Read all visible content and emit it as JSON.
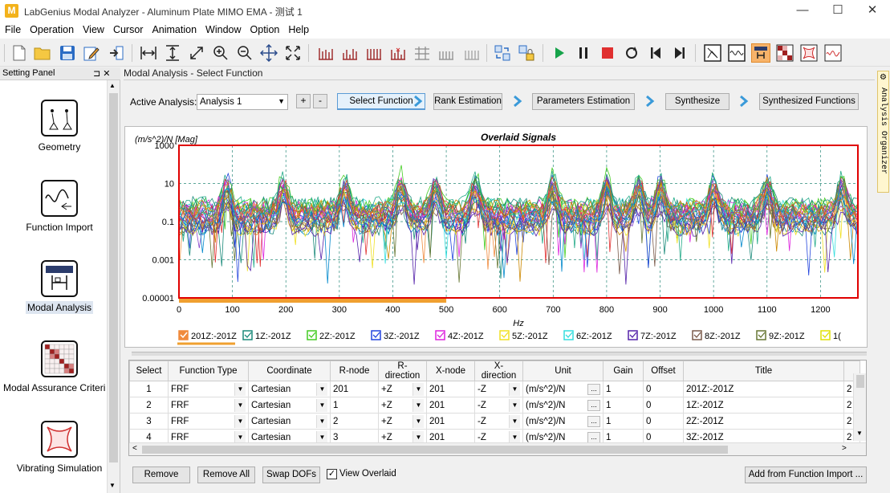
{
  "window": {
    "title": "LabGenius Modal Analyzer - Aluminum Plate MIMO EMA - 测试 1",
    "logo": "M",
    "minimize": "—",
    "maximize": "☐",
    "close": "✕"
  },
  "menu": [
    "File",
    "Operation",
    "View",
    "Cursor",
    "Animation",
    "Window",
    "Option",
    "Help"
  ],
  "toolbar_icons": [
    "new-file-icon",
    "open-folder-icon",
    "save-icon",
    "edit-icon",
    "import-icon",
    "fit-width-icon",
    "fit-height-icon",
    "zoom-diagonal-icon",
    "zoom-in-icon",
    "zoom-out-icon",
    "pan-icon",
    "zoom-fit-icon",
    "grid-view-1-icon",
    "grid-view-2-icon",
    "grid-view-3-icon",
    "grid-view-4-icon",
    "grid-view-5-icon",
    "grid-view-6-icon",
    "grid-view-7-icon",
    "refresh-swap-icon",
    "lock-icon",
    "play-icon",
    "pause-icon",
    "stop-icon",
    "loop-icon",
    "skip-start-icon",
    "skip-end-icon",
    "geometry-tool-icon",
    "function-tool-icon",
    "modal-tool-icon",
    "mac-tool-icon",
    "vibration-tool-icon",
    "signal-tool-icon"
  ],
  "setting_panel": {
    "title": "Setting Panel",
    "pin": "⊐ ✕",
    "modules": [
      {
        "label": "Geometry",
        "icon": "geometry-icon"
      },
      {
        "label": "Function Import",
        "icon": "function-import-icon"
      },
      {
        "label": "Modal Analysis",
        "icon": "modal-analysis-icon"
      },
      {
        "label": "Modal Assurance Criteri",
        "icon": "mac-matrix-icon"
      },
      {
        "label": "Vibrating Simulation",
        "icon": "vibrating-simulation-icon"
      }
    ]
  },
  "main": {
    "title": "Modal Analysis - Select Function",
    "active_analysis_label": "Active Analysis:",
    "active_analysis_value": "Analysis 1",
    "add": "+",
    "remove_analysis": "-",
    "steps": [
      "Select Function",
      "Rank Estimation",
      "Parameters Estimation",
      "Synthesize",
      "Synthesized Functions"
    ],
    "active_step": 0
  },
  "chart_data": {
    "type": "line",
    "title": "Overlaid Signals",
    "ylabel": "(m/s^2)/N [Mag]",
    "xlabel": "Hz",
    "yscale": "log",
    "ylim": [
      1e-05,
      1000
    ],
    "yticks": [
      "1000",
      "10",
      "0.1",
      "0.001",
      "0.00001"
    ],
    "xlim": [
      0,
      1270
    ],
    "xticks": [
      "0",
      "100",
      "200",
      "300",
      "400",
      "500",
      "600",
      "700",
      "800",
      "900",
      "1000",
      "1100",
      "1200"
    ],
    "grid": true,
    "selected_range": [
      0,
      500
    ],
    "resonance_peaks_hz": [
      90,
      195,
      310,
      415,
      480,
      555,
      700,
      800,
      860,
      900,
      1000,
      1100,
      1240
    ],
    "legend": [
      {
        "name": "201Z:-201Z",
        "color": "#f08a3c"
      },
      {
        "name": "1Z:-201Z",
        "color": "#1a8a7a"
      },
      {
        "name": "2Z:-201Z",
        "color": "#44cc22"
      },
      {
        "name": "3Z:-201Z",
        "color": "#2244dd"
      },
      {
        "name": "4Z:-201Z",
        "color": "#dd22dd"
      },
      {
        "name": "5Z:-201Z",
        "color": "#f0e020"
      },
      {
        "name": "6Z:-201Z",
        "color": "#33dddd"
      },
      {
        "name": "7Z:-201Z",
        "color": "#5522aa"
      },
      {
        "name": "8Z:-201Z",
        "color": "#7a5a4a"
      },
      {
        "name": "9Z:-201Z",
        "color": "#667733"
      },
      {
        "name": "1(",
        "color": "#e0e000"
      }
    ]
  },
  "table": {
    "columns": [
      "Select",
      "Function Type",
      "Coordinate",
      "R-node",
      "R-direction",
      "X-node",
      "X-direction",
      "Unit",
      "Gain",
      "Offset",
      "Title"
    ],
    "rows": [
      [
        "1",
        "FRF",
        "Cartesian",
        "201",
        "+Z",
        "201",
        "-Z",
        "(m/s^2)/N",
        "1",
        "0",
        "201Z:-201Z"
      ],
      [
        "2",
        "FRF",
        "Cartesian",
        "1",
        "+Z",
        "201",
        "-Z",
        "(m/s^2)/N",
        "1",
        "0",
        "1Z:-201Z"
      ],
      [
        "3",
        "FRF",
        "Cartesian",
        "2",
        "+Z",
        "201",
        "-Z",
        "(m/s^2)/N",
        "1",
        "0",
        "2Z:-201Z"
      ],
      [
        "4",
        "FRF",
        "Cartesian",
        "3",
        "+Z",
        "201",
        "-Z",
        "(m/s^2)/N",
        "1",
        "0",
        "3Z:-201Z"
      ]
    ],
    "ellipsis": "...",
    "overflow": "2"
  },
  "bottom": {
    "remove": "Remove",
    "remove_all": "Remove All",
    "swap": "Swap DOFs",
    "view_overlaid": "View Overlaid",
    "view_overlaid_checked": true,
    "add_from_import": "Add from Function Import ..."
  },
  "organizer_tab": "Analysis Organizer",
  "colors": {
    "accent_orange": "#f0a030",
    "plot_border": "#e00000",
    "selection_blue": "#5b9bd5"
  }
}
